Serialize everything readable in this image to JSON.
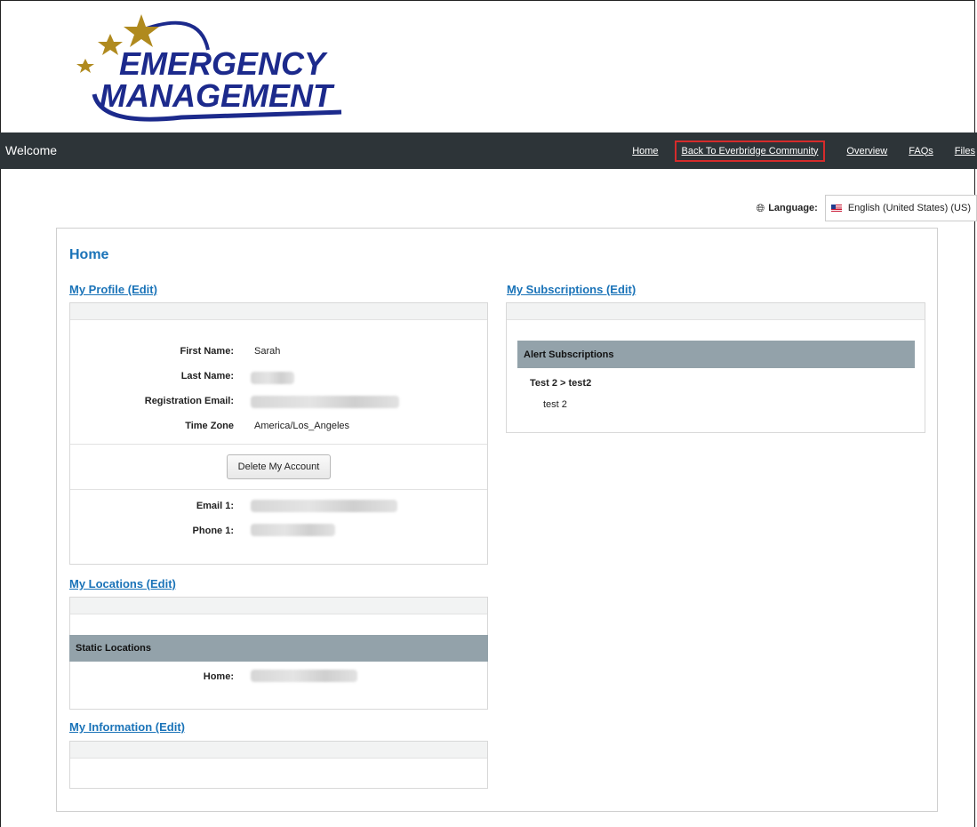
{
  "logo": {
    "line1": "EMERGENCY",
    "line2": "MANAGEMENT",
    "colors": {
      "text": "#1c2a8c",
      "star": "#b08a1e",
      "swoosh": "#1c2a8c"
    }
  },
  "nav": {
    "welcome": "Welcome",
    "links": [
      "Home",
      "Back To Everbridge Community",
      "Overview",
      "FAQs",
      "Files"
    ]
  },
  "language": {
    "label": "Language:",
    "selected": "English (United States) (US)",
    "icon": "globe-icon"
  },
  "page": {
    "title": "Home"
  },
  "profile": {
    "link": "My Profile (Edit)",
    "fields": {
      "first_name_label": "First Name:",
      "first_name": "Sarah",
      "last_name_label": "Last Name:",
      "email_label": "Registration Email:",
      "timezone_label": "Time Zone",
      "timezone": "America/Los_Angeles"
    },
    "delete_button": "Delete My Account",
    "contacts": {
      "email_label": "Email 1:",
      "phone_label": "Phone 1:"
    }
  },
  "locations": {
    "link": "My Locations (Edit)",
    "header": "Static Locations",
    "home_label": "Home:"
  },
  "information": {
    "link": "My Information (Edit)"
  },
  "subscriptions": {
    "link": "My Subscriptions (Edit)",
    "header": "Alert Subscriptions",
    "group": "Test 2 > test2",
    "item": "test 2"
  },
  "colors": {
    "nav_bg": "#2d3438",
    "link": "#1a73b8",
    "section_header": "#93a2aa",
    "highlight_border": "#d62b2b"
  }
}
